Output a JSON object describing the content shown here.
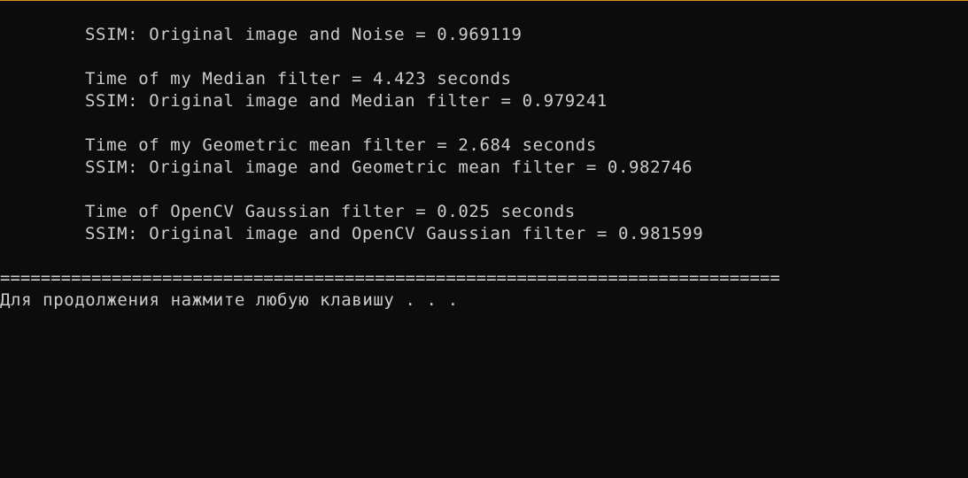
{
  "console": {
    "lines": [
      "SSIM: Original image and Noise = 0.969119",
      "Time of my Median filter = 4.423 seconds",
      "SSIM: Original image and Median filter = 0.979241",
      "Time of my Geometric mean filter = 2.684 seconds",
      "SSIM: Original image and Geometric mean filter = 0.982746",
      "Time of OpenCV Gaussian filter = 0.025 seconds",
      "SSIM: Original image and OpenCV Gaussian filter = 0.981599"
    ],
    "separator": "=============================================================================",
    "prompt": "Для продолжения нажмите любую клавишу . . ."
  },
  "colors": {
    "background": "#0c0c0c",
    "text": "#cccccc",
    "window_border": "#d9951f"
  }
}
